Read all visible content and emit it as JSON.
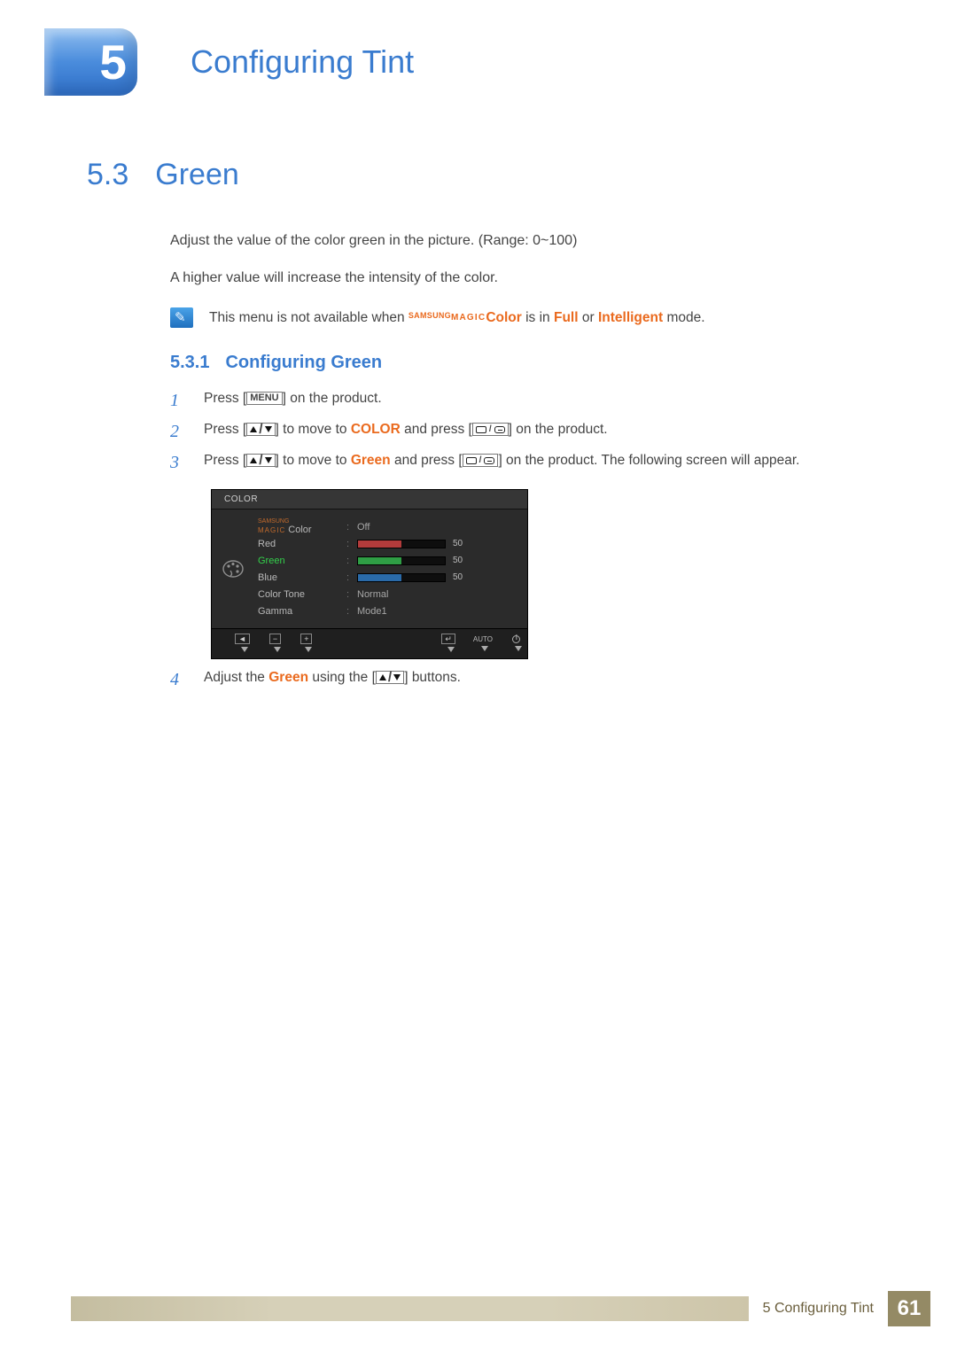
{
  "chapter": {
    "number": "5",
    "title": "Configuring Tint"
  },
  "section": {
    "number": "5.3",
    "title": "Green"
  },
  "intro": {
    "p1": "Adjust the value of the color green in the picture. (Range: 0~100)",
    "p2": "A higher value will increase the intensity of the color."
  },
  "note": {
    "before": "This menu is not available when ",
    "samsung": "SAMSUNG",
    "magic": "MAGIC",
    "color": "Color",
    "mid1": " is in ",
    "full": "Full",
    "mid2": " or ",
    "intelligent": "Intelligent",
    "after": " mode."
  },
  "subsection": {
    "number": "5.3.1",
    "title": "Configuring Green"
  },
  "steps": {
    "s1": {
      "num": "1",
      "a": "Press [",
      "menu": "MENU",
      "b": "] on the product."
    },
    "s2": {
      "num": "2",
      "a": "Press [",
      "b": "] to move to ",
      "color": "COLOR",
      "c": " and press [",
      "d": "] on the product."
    },
    "s3": {
      "num": "3",
      "a": "Press [",
      "b": "] to move to ",
      "green": "Green",
      "c": " and press [",
      "d": "] on the product. The following screen will appear."
    },
    "s4": {
      "num": "4",
      "a": "Adjust the ",
      "green": "Green",
      "b": " using the [",
      "c": "] buttons."
    }
  },
  "osd": {
    "title": "COLOR",
    "rows": {
      "magic": {
        "samsung": "SAMSUNG",
        "magic": "MAGIC",
        "suffix": " Color",
        "value": "Off"
      },
      "red": {
        "label": "Red",
        "value": "50",
        "pct": 50
      },
      "green": {
        "label": "Green",
        "value": "50",
        "pct": 50
      },
      "blue": {
        "label": "Blue",
        "value": "50",
        "pct": 50
      },
      "tone": {
        "label": "Color Tone",
        "value": "Normal"
      },
      "gamma": {
        "label": "Gamma",
        "value": "Mode1"
      }
    },
    "footer": {
      "back": "◄",
      "minus": "−",
      "plus": "+",
      "enter": "↵",
      "auto": "AUTO"
    }
  },
  "footer": {
    "crumb": "5 Configuring Tint",
    "page": "61"
  }
}
